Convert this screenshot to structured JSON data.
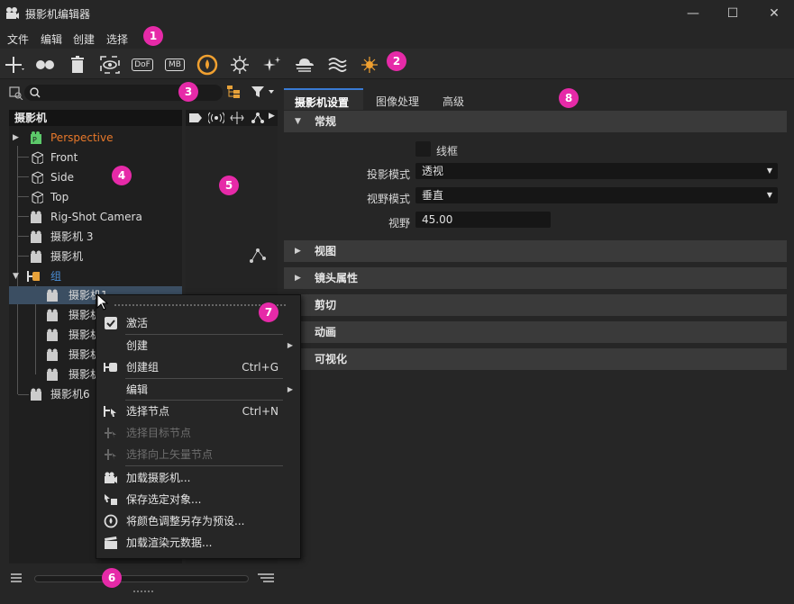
{
  "window": {
    "title": "摄影机编辑器",
    "min": "—",
    "max": "☐",
    "close": "✕"
  },
  "menu": [
    "文件",
    "编辑",
    "创建",
    "选择"
  ],
  "badges": [
    "1",
    "2",
    "3",
    "4",
    "5",
    "6",
    "7",
    "8"
  ],
  "toolbar": {
    "dof": "DoF",
    "mb": "MB"
  },
  "tree": {
    "header": "摄影机",
    "items": [
      "Perspective",
      "Front",
      "Side",
      "Top",
      "Rig-Shot Camera",
      "摄影机 3",
      "摄影机",
      "组",
      "摄影机1",
      "摄影机",
      "摄影机",
      "摄影机",
      "摄影机",
      "摄影机6"
    ]
  },
  "tabs": [
    "摄影机设置",
    "图像处理",
    "高级"
  ],
  "sections": {
    "general": "常规",
    "view": "视图",
    "lens": "镜头属性",
    "clip": "剪切",
    "anim": "动画",
    "vis": "可视化"
  },
  "fields": {
    "wireframe": "线框",
    "projection_label": "投影模式",
    "projection_value": "透视",
    "fov_mode_label": "视野模式",
    "fov_mode_value": "垂直",
    "fov_label": "视野",
    "fov_value": "45.00"
  },
  "context_menu": {
    "activate": "激活",
    "create": "创建",
    "create_group": "创建组",
    "create_group_sc": "Ctrl+G",
    "edit": "编辑",
    "select_node": "选择节点",
    "select_node_sc": "Ctrl+N",
    "select_target": "选择目标节点",
    "select_upvector": "选择向上矢量节点",
    "load_camera": "加载摄影机...",
    "save_selected": "保存选定对象...",
    "save_color": "将颜色调整另存为预设...",
    "load_render": "加载渲染元数据..."
  },
  "colors": {
    "accent": "#e62aa8",
    "selection": "#3b4e62",
    "perspective": "#e8782a",
    "group": "#4b8fd8"
  }
}
